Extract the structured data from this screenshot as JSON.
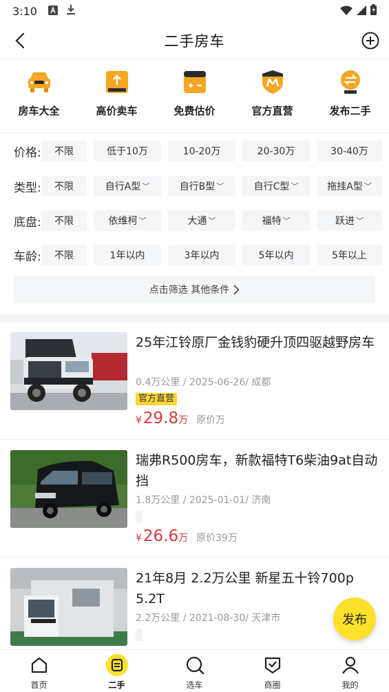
{
  "status": {
    "time": "3:10"
  },
  "header": {
    "title": "二手房车"
  },
  "quick": [
    {
      "label": "房车大全",
      "icon": "car-icon"
    },
    {
      "label": "高价卖车",
      "icon": "sell-icon"
    },
    {
      "label": "免费估价",
      "icon": "calculator-icon"
    },
    {
      "label": "官方直营",
      "icon": "official-shield-icon"
    },
    {
      "label": "发布二手",
      "icon": "exchange-icon"
    }
  ],
  "filters": {
    "price": {
      "label": "价格:",
      "options": [
        "不限",
        "低于10万",
        "10-20万",
        "20-30万",
        "30-40万"
      ]
    },
    "type": {
      "label": "类型:",
      "options": [
        "不限",
        "自行A型",
        "自行B型",
        "自行C型",
        "拖挂A型"
      ]
    },
    "chassis": {
      "label": "底盘:",
      "options": [
        "不限",
        "依维柯",
        "大通",
        "福特",
        "跃进"
      ]
    },
    "age": {
      "label": "车龄:",
      "options": [
        "不限",
        "1年以内",
        "3年以内",
        "5年以内",
        "5年以上"
      ]
    },
    "more": "点击筛选 其他条件"
  },
  "listings": [
    {
      "title": "25年江铃原厂金钱豹硬升顶四驱越野房车",
      "meta": "0.4万公里 / 2025-06-26/ 成都",
      "badge": "官方直营",
      "yen": "¥",
      "price": "29.8",
      "unit": "万",
      "orig": "原价万"
    },
    {
      "title": "瑞弗R500房车，新款福特T6柴油9at自动挡",
      "meta": "1.8万公里 / 2025-01-01/ 济南",
      "badge": "",
      "yen": "¥",
      "price": "26.6",
      "unit": "万",
      "orig": "原价39万"
    },
    {
      "title": "21年8月 2.2万公里 新星五十铃700p 5.2T",
      "meta": "2.2万公里 / 2021-08-30/ 天津市",
      "badge": "",
      "yen": "",
      "price": "",
      "unit": "",
      "orig": ""
    }
  ],
  "fab": "发布",
  "nav": [
    {
      "label": "首页",
      "icon": "home-icon"
    },
    {
      "label": "二手",
      "icon": "used-car-icon"
    },
    {
      "label": "选车",
      "icon": "search-icon"
    },
    {
      "label": "商圈",
      "icon": "shopping-icon"
    },
    {
      "label": "我的",
      "icon": "profile-icon"
    }
  ],
  "colors": {
    "accent": "#fde02a",
    "price": "#d73a3a",
    "icon_orange": "#f5a623"
  }
}
